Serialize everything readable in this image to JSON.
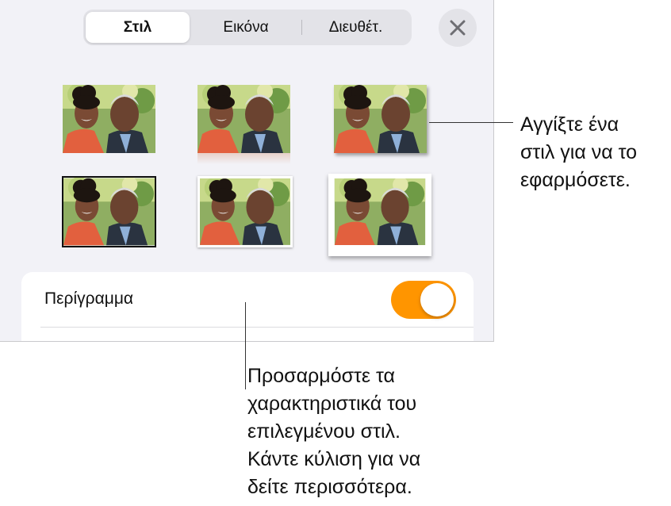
{
  "tabs": [
    {
      "label": "Στιλ",
      "selected": true
    },
    {
      "label": "Εικόνα",
      "selected": false
    },
    {
      "label": "Διευθέτ.",
      "selected": false
    }
  ],
  "close_icon": "close-icon",
  "styles": [
    {
      "name": "plain"
    },
    {
      "name": "reflection"
    },
    {
      "name": "drop-shadow"
    },
    {
      "name": "thin-black-border"
    },
    {
      "name": "white-frame-shadow"
    },
    {
      "name": "curled-frame-shadow"
    }
  ],
  "border_row": {
    "label": "Περίγραμμα",
    "toggle_on": true,
    "toggle_color": "#ff9500"
  },
  "callouts": {
    "styles_lines": [
      "Αγγίξτε ένα",
      "στιλ για να το",
      "εφαρμόσετε."
    ],
    "border_lines": [
      "Προσαρμόστε τα",
      "χαρακτηριστικά του",
      "επιλεγμένου στιλ.",
      "Κάντε κύλιση για να",
      "δείτε περισσότερα."
    ]
  }
}
